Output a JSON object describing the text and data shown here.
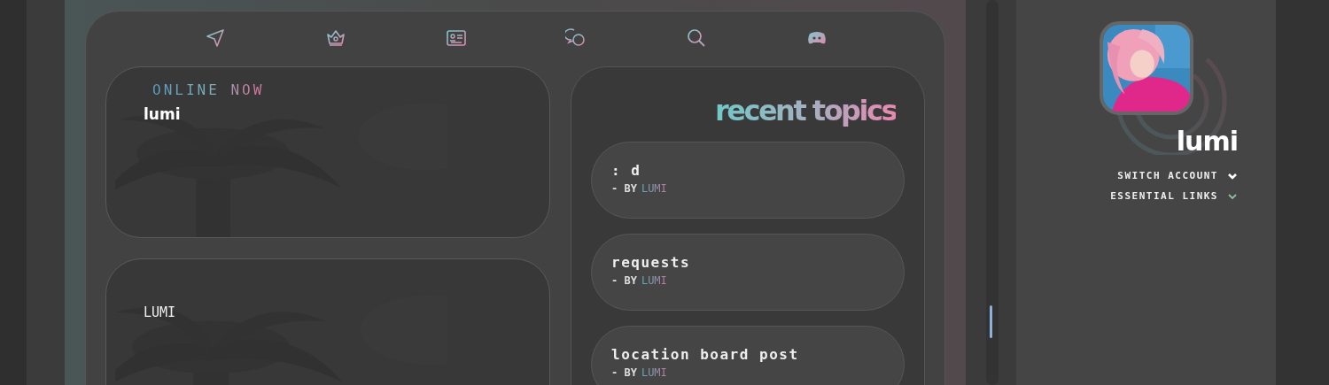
{
  "online_panel": {
    "heading": "ONLINE NOW",
    "users": [
      "lumi"
    ]
  },
  "second_panel": {
    "text": "LUMI"
  },
  "recent_topics": {
    "title": "recent topics",
    "topics": [
      {
        "title": ": d",
        "by": "- BY",
        "author": "LUMI"
      },
      {
        "title": "requests",
        "by": "- BY",
        "author": "LUMI"
      },
      {
        "title": "location board post",
        "by": "- BY",
        "author": "LUMI"
      }
    ]
  },
  "profile": {
    "username": "lumi",
    "menus": [
      {
        "label": "SWITCH ACCOUNT",
        "color": "#ffffff"
      },
      {
        "label": "ESSENTIAL LINKS",
        "color": "#8fbf9f"
      }
    ]
  }
}
